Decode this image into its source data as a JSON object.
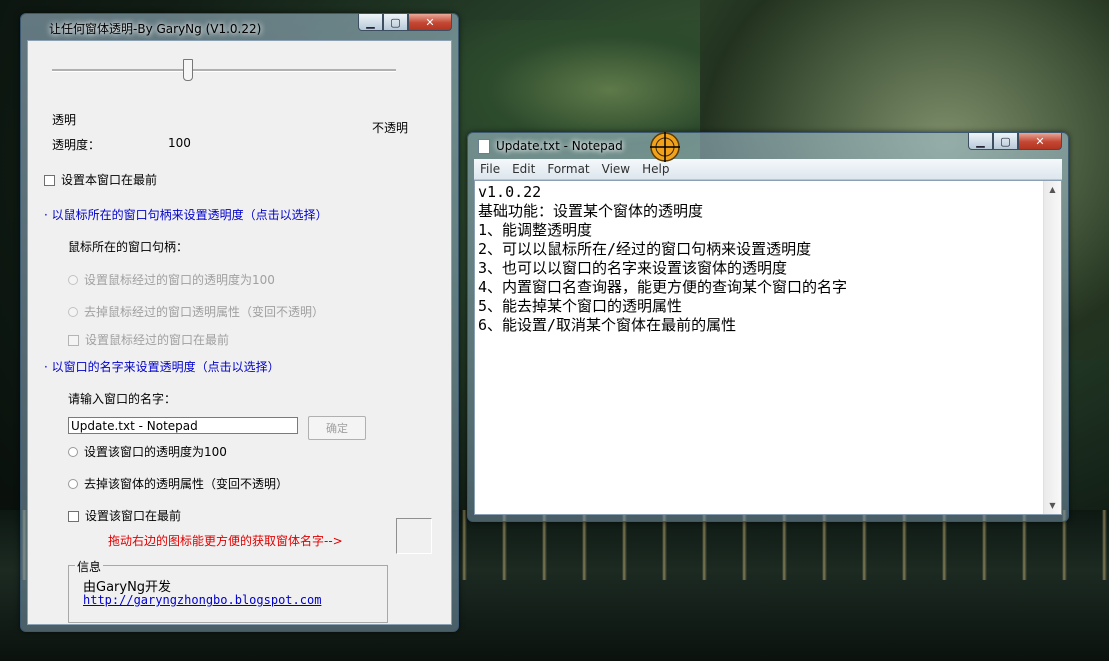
{
  "main_window": {
    "title": "让任何窗体透明-By GaryNg (V1.0.22)",
    "slider": {
      "value": 100,
      "max": 255
    },
    "label_transparent": "透明",
    "label_opaque": "不透明",
    "label_opacity": "透明度：",
    "opacity_value": "100",
    "topmost_self": "设置本窗口在最前",
    "section_mouse": "· 以鼠标所在的窗口句柄来设置透明度（点击以选择）",
    "mouse_handle_label": "鼠标所在的窗口句柄：",
    "mouse_opt_set": "设置鼠标经过的窗口的透明度为100",
    "mouse_opt_remove": "去掉鼠标经过的窗口透明属性（变回不透明）",
    "mouse_opt_topmost": "设置鼠标经过的窗口在最前",
    "section_name": "· 以窗口的名字来设置透明度（点击以选择）",
    "name_input_label": "请输入窗口的名字：",
    "name_input_value": "Update.txt - Notepad",
    "ok_button": "确定",
    "name_opt_set": "设置该窗口的透明度为100",
    "name_opt_remove": "去掉该窗体的透明属性（变回不透明）",
    "name_opt_topmost": "设置该窗口在最前",
    "drag_hint": "拖动右边的图标能更方便的获取窗体名字-->",
    "info_group_title": "信息",
    "info_author": "由GaryNg开发",
    "info_link": "http://garyngzhongbo.blogspot.com",
    "colors": {
      "section_blue": "#0000cc",
      "hint_red": "#e00000"
    }
  },
  "notepad": {
    "title": "Update.txt - Notepad",
    "menu": [
      "File",
      "Edit",
      "Format",
      "View",
      "Help"
    ],
    "lines": [
      "v1.0.22",
      "基础功能：设置某个窗体的透明度",
      "1、能调整透明度",
      "2、可以以鼠标所在/经过的窗口句柄来设置透明度",
      "3、也可以以窗口的名字来设置该窗体的透明度",
      "4、内置窗口名查询器，能更方便的查询某个窗口的名字",
      "5、能去掉某个窗口的透明属性",
      "6、能设置/取消某个窗体在最前的属性"
    ]
  },
  "icons": {
    "crosshair": "crosshair-target-icon",
    "minimize": "minimize-icon",
    "maximize": "maximize-icon",
    "close": "close-icon"
  }
}
